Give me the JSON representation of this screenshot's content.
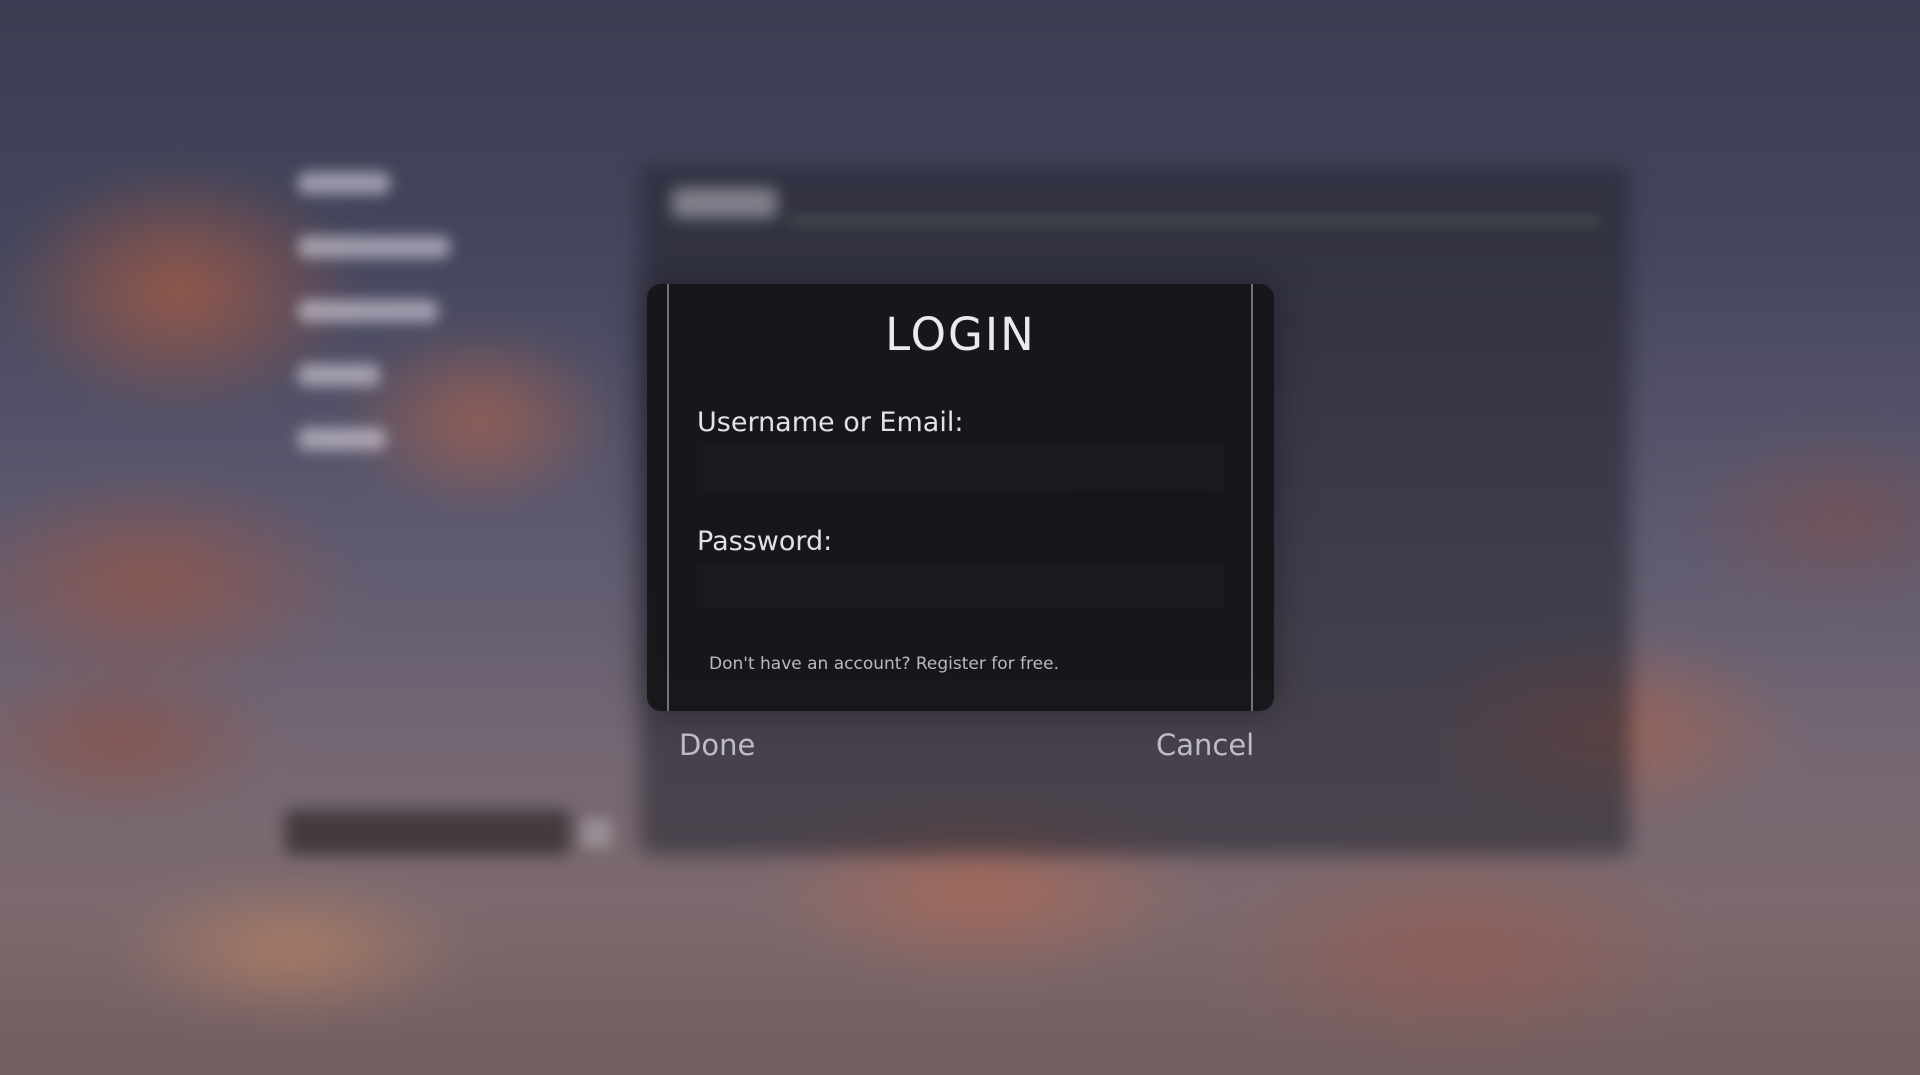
{
  "dialog": {
    "title": "LOGIN",
    "username_label": "Username or Email:",
    "username_value": "",
    "password_label": "Password:",
    "password_value": "",
    "register_text": "Don't have an account? Register for free."
  },
  "actions": {
    "done_label": "Done",
    "cancel_label": "Cancel"
  },
  "colors": {
    "dialog_bg": "#141418",
    "text_primary": "#e9e9ee",
    "text_muted": "#b9b9bf"
  }
}
